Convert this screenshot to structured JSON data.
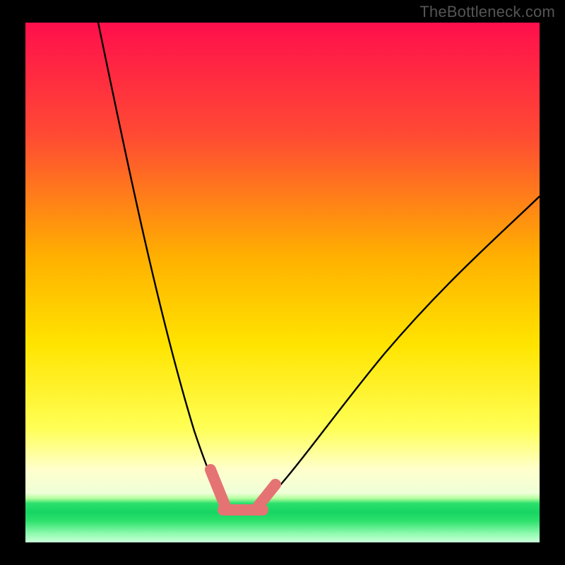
{
  "watermark": "TheBottleneck.com",
  "colors": {
    "black": "#000000",
    "curve": "#000000",
    "salmon": "#E57373",
    "green_band": "#2BE06B",
    "grad_top": "#FF0F4C",
    "grad_mid1": "#FF6F2C",
    "grad_mid2": "#FFD900",
    "grad_mid3": "#FFFF66",
    "grad_mid4": "#F5FFCC",
    "grad_bottom_yellow": "#FFFFE0"
  },
  "chart_data": {
    "type": "line",
    "title": "",
    "xlabel": "",
    "ylabel": "",
    "xlim": [
      0,
      100
    ],
    "ylim": [
      0,
      100
    ],
    "legend": false,
    "grid": false,
    "series": [
      {
        "name": "left-curve",
        "x": [
          14,
          16,
          18,
          20,
          22,
          24,
          26,
          28,
          30,
          32,
          34,
          36,
          37.5
        ],
        "y": [
          100,
          92,
          82,
          73,
          64,
          55,
          46,
          38,
          30,
          23,
          17,
          12,
          9
        ]
      },
      {
        "name": "right-curve",
        "x": [
          45,
          48,
          52,
          56,
          60,
          65,
          70,
          75,
          80,
          85,
          90,
          95,
          100
        ],
        "y": [
          9,
          12,
          17,
          22,
          27,
          33,
          39,
          44,
          49,
          54,
          59,
          63,
          67
        ]
      },
      {
        "name": "salmon-left-segment",
        "x": [
          35.5,
          37.5
        ],
        "y": [
          14.5,
          8.5
        ]
      },
      {
        "name": "salmon-bottom-segment",
        "x": [
          37.5,
          45
        ],
        "y": [
          7.5,
          7.5
        ]
      },
      {
        "name": "salmon-right-segment",
        "x": [
          44.5,
          47
        ],
        "y": [
          8.5,
          12.5
        ]
      }
    ],
    "note": "Axis values are estimated percentages (0–100) of the plot area; the image has no numeric tick labels."
  }
}
